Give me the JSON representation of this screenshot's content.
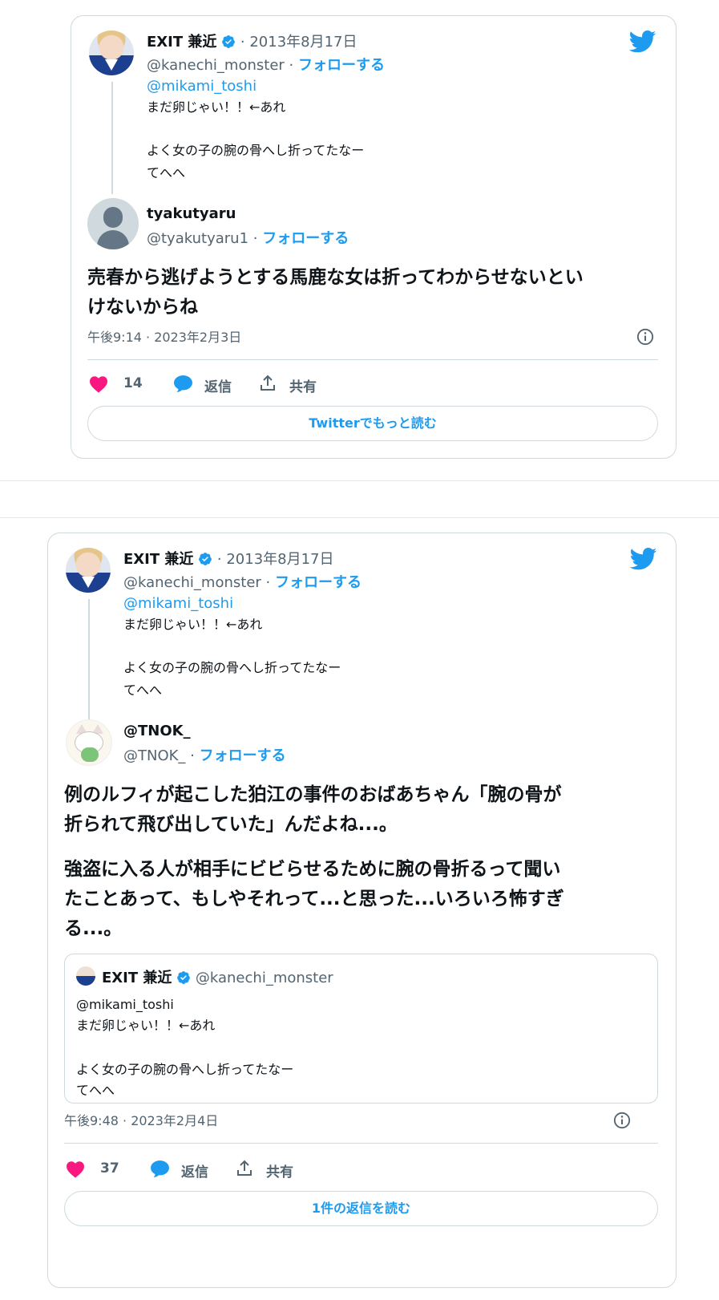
{
  "colors": {
    "accent": "#1d9bf0",
    "like": "#f91880",
    "border": "#cfd9de",
    "muted": "#536471"
  },
  "embed1": {
    "parent": {
      "name": "EXIT 兼近",
      "date": "2013年8月17日",
      "handle": "@kanechi_monster",
      "follow": "フォローする",
      "mention": "@mikami_toshi",
      "line1": "まだ卵じゃい！！←あれ",
      "line2": "よく女の子の腕の骨へし折ってたなー",
      "line3": "てへへ"
    },
    "reply": {
      "name": "tyakutyaru",
      "handle": "@tyakutyaru1",
      "follow": "フォローする",
      "text1": "売春から逃げようとする馬鹿な女は折ってわからせないとい",
      "text2": "けないからね"
    },
    "timestamp": "午後9:14 · 2023年2月3日",
    "likes": "14",
    "reply_label": "返信",
    "share_label": "共有",
    "read_more": "Twitterでもっと読む"
  },
  "embed2": {
    "parent": {
      "name": "EXIT 兼近",
      "date": "2013年8月17日",
      "handle": "@kanechi_monster",
      "follow": "フォローする",
      "mention": "@mikami_toshi",
      "line1": "まだ卵じゃい！！←あれ",
      "line2": "よく女の子の腕の骨へし折ってたなー",
      "line3": "てへへ"
    },
    "reply": {
      "name": "@TNOK_",
      "handle": "@TNOK_",
      "follow": "フォローする",
      "para1_l1": "例のルフィが起こした狛江の事件のおばあちゃん「腕の骨が",
      "para1_l2": "折られて飛び出していた」んだよね...。",
      "para2_l1": "強盗に入る人が相手にビビらせるために腕の骨折るって聞い",
      "para2_l2": "たことあって、もしやそれって...と思った...いろいろ怖すぎ",
      "para2_l3": "る...。"
    },
    "quote": {
      "name": "EXIT 兼近",
      "handle": "@kanechi_monster",
      "mention": "@mikami_toshi",
      "line1": "まだ卵じゃい！！←あれ",
      "line2": "よく女の子の腕の骨へし折ってたなー",
      "line3": "てへへ"
    },
    "timestamp": "午後9:48 · 2023年2月4日",
    "likes": "37",
    "reply_label": "返信",
    "share_label": "共有",
    "read_more": "1件の返信を読む"
  }
}
